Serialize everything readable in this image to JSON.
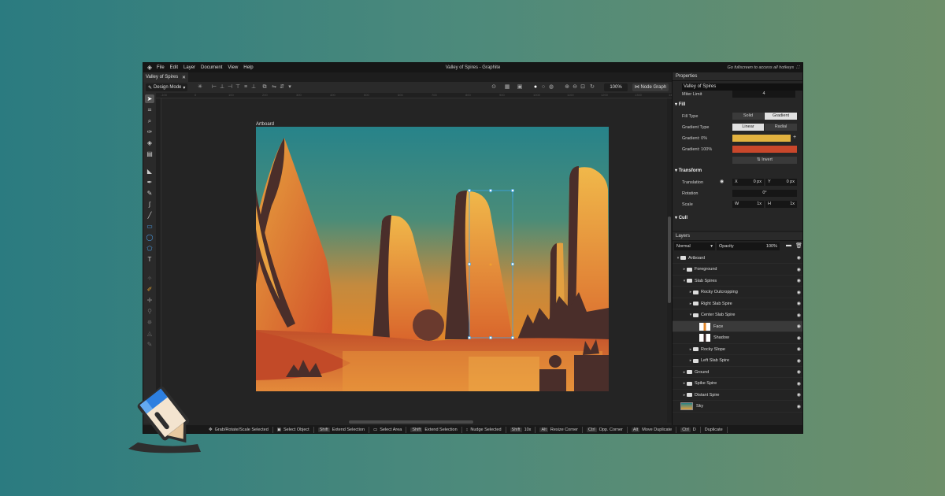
{
  "menubar": {
    "logo_icon": "graphite-logo-icon",
    "items": [
      "File",
      "Edit",
      "Layer",
      "Document",
      "View",
      "Help"
    ],
    "title": "Valley of Spires - Graphite",
    "fullscreen_hint": "Go fullscreen to access all hotkeys"
  },
  "tabs": [
    {
      "label": "Valley of Spires",
      "close": "✕"
    }
  ],
  "options": {
    "mode": "Design Mode",
    "zoom": "100%",
    "node_graph": "Node Graph"
  },
  "canvas": {
    "artboard_label": "Artboard",
    "ruler_ticks": [
      "-100",
      "0",
      "100",
      "200",
      "300",
      "400",
      "500",
      "600",
      "700",
      "800",
      "900",
      "1000",
      "1100",
      "1200",
      "1300",
      "1400",
      "1500",
      "1600",
      "1700",
      "1800",
      "1900"
    ]
  },
  "properties": {
    "header": "Properties",
    "name": "Valley of Spires",
    "miter_label": "Miter Limit",
    "miter_value": "4",
    "fill_section": "Fill",
    "fill_type_label": "Fill Type",
    "fill_type_options": [
      "Solid",
      "Gradient"
    ],
    "gradient_type_label": "Gradient Type",
    "gradient_type_options": [
      "Linear",
      "Radial"
    ],
    "gradient0_label": "Gradient: 0%",
    "gradient0_color": "#e2b23f",
    "gradient100_label": "Gradient: 100%",
    "gradient100_color": "#c9472b",
    "invert_label": "Invert",
    "transform_section": "Transform",
    "translation_label": "Translation",
    "translation_x_label": "X",
    "translation_x": "0 px",
    "translation_y_label": "Y",
    "translation_y": "0 px",
    "rotation_label": "Rotation",
    "rotation_value": "0°",
    "scale_label": "Scale",
    "scale_w_label": "W",
    "scale_w": "1x",
    "scale_h_label": "H",
    "scale_h": "1x",
    "cull_section": "Cull"
  },
  "layers": {
    "header": "Layers",
    "blend_mode": "Normal",
    "opacity_label": "Opacity",
    "opacity_value": "100%",
    "items": [
      {
        "name": "Artboard",
        "indent": 0
      },
      {
        "name": "Foreground",
        "indent": 1
      },
      {
        "name": "Slab Spires",
        "indent": 1
      },
      {
        "name": "Rocky Outcropping",
        "indent": 2
      },
      {
        "name": "Right Slab Spire",
        "indent": 2
      },
      {
        "name": "Center Slab Spire",
        "indent": 2
      },
      {
        "name": "Face",
        "indent": 3
      },
      {
        "name": "Shadow",
        "indent": 3
      },
      {
        "name": "Rocky Slope",
        "indent": 2
      },
      {
        "name": "Left Slab Spire",
        "indent": 2
      },
      {
        "name": "Ground",
        "indent": 1
      },
      {
        "name": "Spike Spire",
        "indent": 1
      },
      {
        "name": "Distant Spire",
        "indent": 1
      },
      {
        "name": "Sky",
        "indent": 0
      }
    ]
  },
  "status": [
    {
      "action": "Grab/Rotate/Scale Selected"
    },
    {
      "action": "Select Object"
    },
    {
      "key": "Shift",
      "action": "Extend Selection"
    },
    {
      "action": "Select Area"
    },
    {
      "key": "Shift",
      "action": "Extend Selection"
    },
    {
      "action": "Nudge Selected"
    },
    {
      "key": "Shift",
      "action": "10x"
    },
    {
      "key": "Alt",
      "action": "Resize Corner"
    },
    {
      "key": "Ctrl",
      "action": "Opp. Corner"
    },
    {
      "key": "Alt",
      "action": "Move Duplicate"
    },
    {
      "key": "Ctrl",
      "action": "D"
    },
    {
      "action": "Duplicate"
    }
  ],
  "colors": {
    "background_left": "#2b7b80",
    "background_right": "#6e8f6a",
    "sky_top": "#2a8287",
    "sky_bottom": "#e08a2b",
    "rock_dark": "#4a2e2a",
    "selection": "#3fa3e6"
  }
}
